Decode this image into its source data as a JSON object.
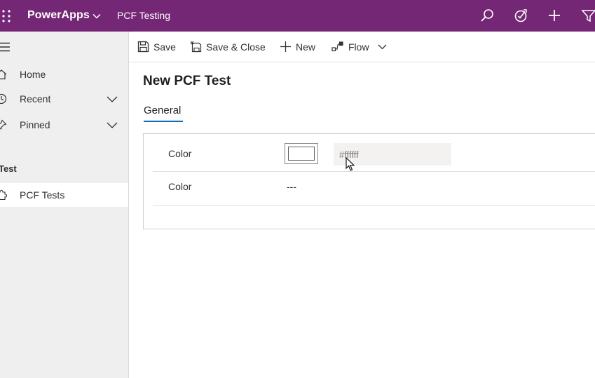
{
  "topbar": {
    "brand": "PowerApps",
    "app_name": "PCF Testing",
    "icons": [
      "waffle-icon",
      "chevron-down-icon",
      "search-icon",
      "assistant-icon",
      "add-icon",
      "filter-icon"
    ],
    "background": "#742774"
  },
  "sidenav": {
    "items": [
      {
        "label": "Home",
        "icon": "home-icon"
      },
      {
        "label": "Recent",
        "icon": "clock-icon",
        "expandable": true
      },
      {
        "label": "Pinned",
        "icon": "pin-icon",
        "expandable": true
      }
    ],
    "group": "Test",
    "entity": {
      "label": "PCF Tests",
      "icon": "puzzle-icon",
      "active": true
    }
  },
  "commands": {
    "save": "Save",
    "save_close": "Save & Close",
    "new": "New",
    "flow": "Flow"
  },
  "form": {
    "title": "New PCF Test",
    "tab": "General",
    "fields": [
      {
        "label": "Color",
        "swatch_color": "#ffffff",
        "placeholder": "#ffffff"
      },
      {
        "label": "Color",
        "value": "---"
      }
    ]
  },
  "colors": {
    "accent": "#0f6cbd",
    "nav_background": "#efefef"
  }
}
